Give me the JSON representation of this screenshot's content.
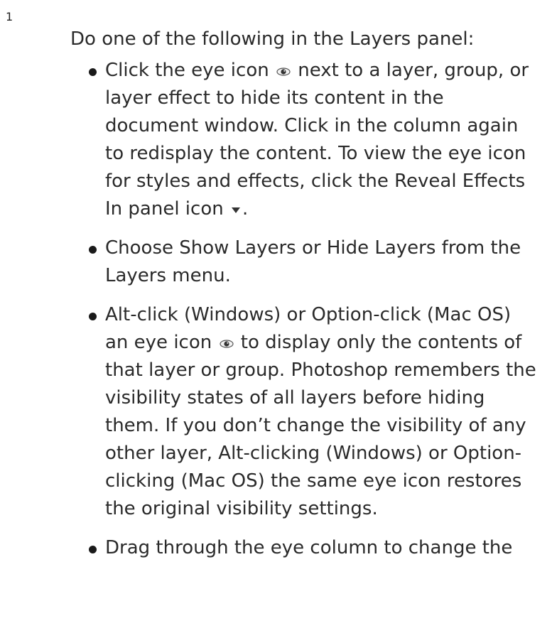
{
  "step_number": "1",
  "intro": "Do one of the following in the Layers panel:",
  "bullets": {
    "b1": {
      "t1": "Click the eye icon",
      "t2": "next to a layer, group, or layer effect to hide its content in the document window. Click in the column again to redisplay the content. To view the eye icon for styles and effects, click the Reveal Effects In panel icon",
      "t3": "."
    },
    "b2": {
      "t1": "Choose Show Layers or Hide Layers from the Layers menu."
    },
    "b3": {
      "t1": "Alt-click (Windows) or Option-click (Mac OS) an eye icon",
      "t2": "to display only the contents of that layer or group. Photoshop remembers the visibility states of all layers before hiding them. If you don’t change the visibility of any other layer, Alt-clicking (Windows) or Option-clicking (Mac OS) the same eye icon restores the original visibility settings."
    },
    "b4": {
      "t1": "Drag through the eye column to change the"
    }
  },
  "icons": {
    "eye": "eye-icon",
    "reveal_effects": "triangle-down-icon"
  }
}
